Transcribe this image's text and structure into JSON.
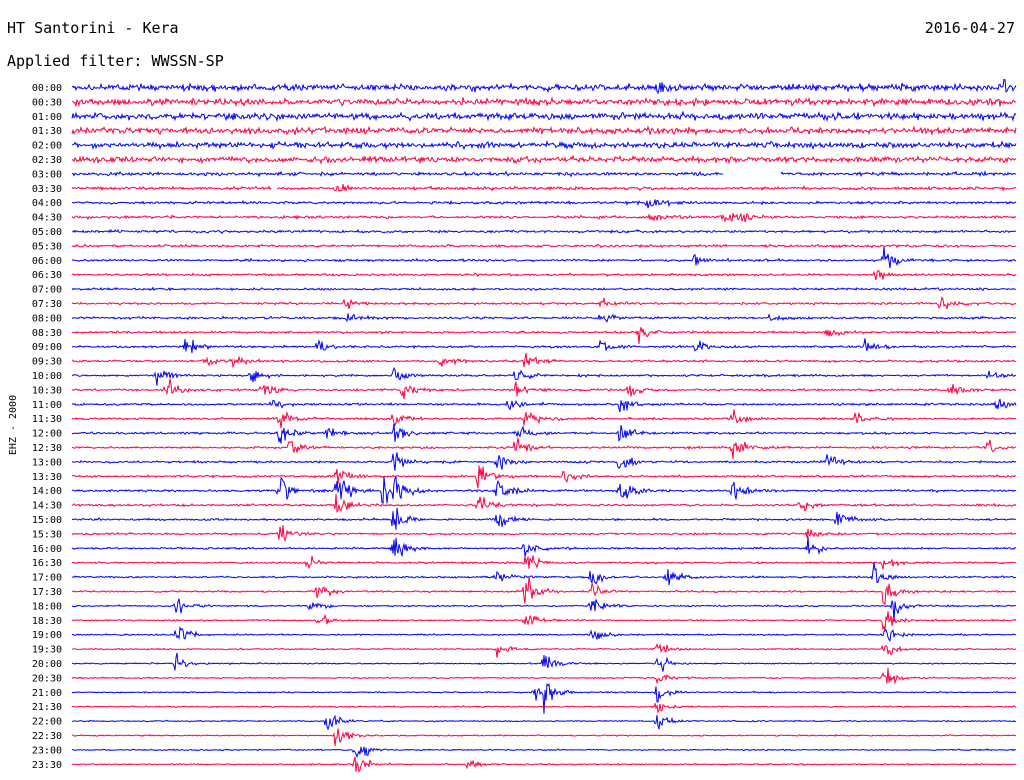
{
  "header": {
    "title": "HT Santorini - Kera",
    "date": "2016-04-27",
    "filter": "Applied filter: WWSSN-SP"
  },
  "chart_data": {
    "type": "line",
    "title": "HT Santorini - Kera",
    "ylabel": "EHZ - 2000",
    "y_categories": [
      "00:00",
      "00:30",
      "01:00",
      "01:30",
      "02:00",
      "02:30",
      "03:00",
      "03:30",
      "04:00",
      "04:30",
      "05:00",
      "05:30",
      "06:00",
      "06:30",
      "07:00",
      "07:30",
      "08:00",
      "08:30",
      "09:00",
      "09:30",
      "10:00",
      "10:30",
      "11:00",
      "11:30",
      "12:00",
      "12:30",
      "13:00",
      "13:30",
      "14:00",
      "14:30",
      "15:00",
      "15:30",
      "16:00",
      "16:30",
      "17:00",
      "17:30",
      "18:00",
      "18:30",
      "19:00",
      "19:30",
      "20:00",
      "20:30",
      "21:00",
      "21:30",
      "22:00",
      "22:30",
      "23:00",
      "23:30"
    ],
    "series_colors": [
      "#0000ff",
      "#ff0040"
    ],
    "noise_level": [
      1.0,
      1.0,
      1.0,
      0.95,
      0.9,
      0.85,
      0.5,
      0.45,
      0.4,
      0.4,
      0.38,
      0.38,
      0.35,
      0.33,
      0.33,
      0.33,
      0.33,
      0.33,
      0.33,
      0.33,
      0.33,
      0.33,
      0.33,
      0.33,
      0.33,
      0.33,
      0.32,
      0.32,
      0.32,
      0.32,
      0.3,
      0.3,
      0.28,
      0.27,
      0.27,
      0.25,
      0.23,
      0.22,
      0.22,
      0.21,
      0.2,
      0.2,
      0.2,
      0.2,
      0.2,
      0.2,
      0.2,
      0.2
    ],
    "events": [
      {
        "row": 0,
        "t": 0.62,
        "amp": 1.4
      },
      {
        "row": 0,
        "t": 0.88,
        "amp": 1.2
      },
      {
        "row": 0,
        "t": 0.985,
        "amp": 1.4
      },
      {
        "row": 7,
        "t": 0.28,
        "amp": 1.0
      },
      {
        "row": 6,
        "t": 0.7,
        "amp": 0.8
      },
      {
        "row": 8,
        "t": 0.61,
        "amp": 1.5
      },
      {
        "row": 9,
        "t": 0.61,
        "amp": 1.8
      },
      {
        "row": 9,
        "t": 0.69,
        "amp": 1.2
      },
      {
        "row": 9,
        "t": 0.71,
        "amp": 1.2
      },
      {
        "row": 12,
        "t": 0.66,
        "amp": 2.0
      },
      {
        "row": 12,
        "t": 0.86,
        "amp": 2.5
      },
      {
        "row": 13,
        "t": 0.85,
        "amp": 1.5
      },
      {
        "row": 15,
        "t": 0.29,
        "amp": 1.3
      },
      {
        "row": 15,
        "t": 0.56,
        "amp": 1.2
      },
      {
        "row": 15,
        "t": 0.92,
        "amp": 1.6
      },
      {
        "row": 16,
        "t": 0.29,
        "amp": 1.5
      },
      {
        "row": 16,
        "t": 0.56,
        "amp": 1.2
      },
      {
        "row": 16,
        "t": 0.74,
        "amp": 1.3
      },
      {
        "row": 17,
        "t": 0.6,
        "amp": 1.8
      },
      {
        "row": 17,
        "t": 0.8,
        "amp": 1.2
      },
      {
        "row": 18,
        "t": 0.12,
        "amp": 2.0
      },
      {
        "row": 18,
        "t": 0.26,
        "amp": 1.3
      },
      {
        "row": 18,
        "t": 0.56,
        "amp": 1.8
      },
      {
        "row": 18,
        "t": 0.66,
        "amp": 1.5
      },
      {
        "row": 18,
        "t": 0.84,
        "amp": 1.5
      },
      {
        "row": 19,
        "t": 0.14,
        "amp": 1.2
      },
      {
        "row": 19,
        "t": 0.17,
        "amp": 1.5
      },
      {
        "row": 19,
        "t": 0.39,
        "amp": 1.3
      },
      {
        "row": 19,
        "t": 0.48,
        "amp": 1.6
      },
      {
        "row": 20,
        "t": 0.09,
        "amp": 2.2
      },
      {
        "row": 20,
        "t": 0.19,
        "amp": 1.8
      },
      {
        "row": 20,
        "t": 0.34,
        "amp": 1.8
      },
      {
        "row": 20,
        "t": 0.47,
        "amp": 1.8
      },
      {
        "row": 20,
        "t": 0.97,
        "amp": 1.5
      },
      {
        "row": 21,
        "t": 0.1,
        "amp": 2.5
      },
      {
        "row": 21,
        "t": 0.2,
        "amp": 2.0
      },
      {
        "row": 21,
        "t": 0.35,
        "amp": 2.5
      },
      {
        "row": 21,
        "t": 0.47,
        "amp": 2.0
      },
      {
        "row": 21,
        "t": 0.59,
        "amp": 2.0
      },
      {
        "row": 21,
        "t": 0.93,
        "amp": 2.0
      },
      {
        "row": 22,
        "t": 0.21,
        "amp": 1.5
      },
      {
        "row": 22,
        "t": 0.46,
        "amp": 2.0
      },
      {
        "row": 22,
        "t": 0.58,
        "amp": 1.8
      },
      {
        "row": 22,
        "t": 0.98,
        "amp": 1.8
      },
      {
        "row": 23,
        "t": 0.22,
        "amp": 2.0
      },
      {
        "row": 23,
        "t": 0.34,
        "amp": 2.2
      },
      {
        "row": 23,
        "t": 0.48,
        "amp": 2.2
      },
      {
        "row": 23,
        "t": 0.7,
        "amp": 2.0
      },
      {
        "row": 23,
        "t": 0.83,
        "amp": 1.5
      },
      {
        "row": 24,
        "t": 0.22,
        "amp": 2.5
      },
      {
        "row": 24,
        "t": 0.27,
        "amp": 2.0
      },
      {
        "row": 24,
        "t": 0.34,
        "amp": 3.0
      },
      {
        "row": 24,
        "t": 0.47,
        "amp": 2.5
      },
      {
        "row": 24,
        "t": 0.58,
        "amp": 2.5
      },
      {
        "row": 25,
        "t": 0.23,
        "amp": 2.0
      },
      {
        "row": 25,
        "t": 0.47,
        "amp": 2.0
      },
      {
        "row": 25,
        "t": 0.7,
        "amp": 2.5
      },
      {
        "row": 25,
        "t": 0.97,
        "amp": 2.0
      },
      {
        "row": 26,
        "t": 0.34,
        "amp": 2.5
      },
      {
        "row": 26,
        "t": 0.45,
        "amp": 2.5
      },
      {
        "row": 26,
        "t": 0.58,
        "amp": 2.5
      },
      {
        "row": 26,
        "t": 0.8,
        "amp": 2.0
      },
      {
        "row": 27,
        "t": 0.28,
        "amp": 3.0
      },
      {
        "row": 27,
        "t": 0.43,
        "amp": 2.5
      },
      {
        "row": 27,
        "t": 0.52,
        "amp": 2.0
      },
      {
        "row": 28,
        "t": 0.22,
        "amp": 3.5
      },
      {
        "row": 28,
        "t": 0.28,
        "amp": 4.0
      },
      {
        "row": 28,
        "t": 0.33,
        "amp": 4.0
      },
      {
        "row": 28,
        "t": 0.34,
        "amp": 4.0
      },
      {
        "row": 28,
        "t": 0.45,
        "amp": 3.5
      },
      {
        "row": 28,
        "t": 0.58,
        "amp": 3.0
      },
      {
        "row": 28,
        "t": 0.7,
        "amp": 2.5
      },
      {
        "row": 29,
        "t": 0.28,
        "amp": 3.5
      },
      {
        "row": 29,
        "t": 0.43,
        "amp": 3.0
      },
      {
        "row": 29,
        "t": 0.77,
        "amp": 2.0
      },
      {
        "row": 30,
        "t": 0.34,
        "amp": 4.0
      },
      {
        "row": 30,
        "t": 0.45,
        "amp": 3.0
      },
      {
        "row": 30,
        "t": 0.81,
        "amp": 2.5
      },
      {
        "row": 31,
        "t": 0.22,
        "amp": 2.5
      },
      {
        "row": 31,
        "t": 0.78,
        "amp": 2.0
      },
      {
        "row": 32,
        "t": 0.34,
        "amp": 3.5
      },
      {
        "row": 32,
        "t": 0.48,
        "amp": 2.0
      },
      {
        "row": 32,
        "t": 0.78,
        "amp": 2.0
      },
      {
        "row": 33,
        "t": 0.48,
        "amp": 2.5
      },
      {
        "row": 33,
        "t": 0.25,
        "amp": 1.5
      },
      {
        "row": 33,
        "t": 0.86,
        "amp": 2.0
      },
      {
        "row": 34,
        "t": 0.55,
        "amp": 2.5
      },
      {
        "row": 34,
        "t": 0.45,
        "amp": 1.5
      },
      {
        "row": 34,
        "t": 0.85,
        "amp": 3.0
      },
      {
        "row": 34,
        "t": 0.63,
        "amp": 2.0
      },
      {
        "row": 35,
        "t": 0.48,
        "amp": 4.0
      },
      {
        "row": 35,
        "t": 0.55,
        "amp": 2.0
      },
      {
        "row": 35,
        "t": 0.86,
        "amp": 3.0
      },
      {
        "row": 35,
        "t": 0.26,
        "amp": 2.0
      },
      {
        "row": 36,
        "t": 0.11,
        "amp": 2.5
      },
      {
        "row": 36,
        "t": 0.55,
        "amp": 3.0
      },
      {
        "row": 36,
        "t": 0.87,
        "amp": 3.0
      },
      {
        "row": 36,
        "t": 0.25,
        "amp": 2.0
      },
      {
        "row": 37,
        "t": 0.48,
        "amp": 2.0
      },
      {
        "row": 37,
        "t": 0.86,
        "amp": 2.5
      },
      {
        "row": 37,
        "t": 0.26,
        "amp": 2.0
      },
      {
        "row": 38,
        "t": 0.11,
        "amp": 2.5
      },
      {
        "row": 38,
        "t": 0.55,
        "amp": 2.0
      },
      {
        "row": 38,
        "t": 0.86,
        "amp": 2.0
      },
      {
        "row": 39,
        "t": 0.45,
        "amp": 2.0
      },
      {
        "row": 39,
        "t": 0.62,
        "amp": 2.0
      },
      {
        "row": 39,
        "t": 0.86,
        "amp": 2.5
      },
      {
        "row": 40,
        "t": 0.11,
        "amp": 2.0
      },
      {
        "row": 40,
        "t": 0.62,
        "amp": 2.5
      },
      {
        "row": 40,
        "t": 0.5,
        "amp": 2.0
      },
      {
        "row": 41,
        "t": 0.62,
        "amp": 2.0
      },
      {
        "row": 41,
        "t": 0.86,
        "amp": 2.5
      },
      {
        "row": 42,
        "t": 0.49,
        "amp": 2.5
      },
      {
        "row": 42,
        "t": 0.5,
        "amp": 2.5
      },
      {
        "row": 42,
        "t": 0.62,
        "amp": 2.5
      },
      {
        "row": 43,
        "t": 0.62,
        "amp": 2.0
      },
      {
        "row": 44,
        "t": 0.27,
        "amp": 3.0
      },
      {
        "row": 44,
        "t": 0.62,
        "amp": 2.0
      },
      {
        "row": 45,
        "t": 0.28,
        "amp": 3.5
      },
      {
        "row": 46,
        "t": 0.3,
        "amp": 3.5
      },
      {
        "row": 47,
        "t": 0.3,
        "amp": 3.5
      },
      {
        "row": 47,
        "t": 0.42,
        "amp": 1.5
      }
    ],
    "gaps": [
      {
        "row": 6,
        "t0": 0.69,
        "t1": 0.75
      },
      {
        "row": 7,
        "t0": 0.211,
        "t1": 0.217
      }
    ]
  }
}
